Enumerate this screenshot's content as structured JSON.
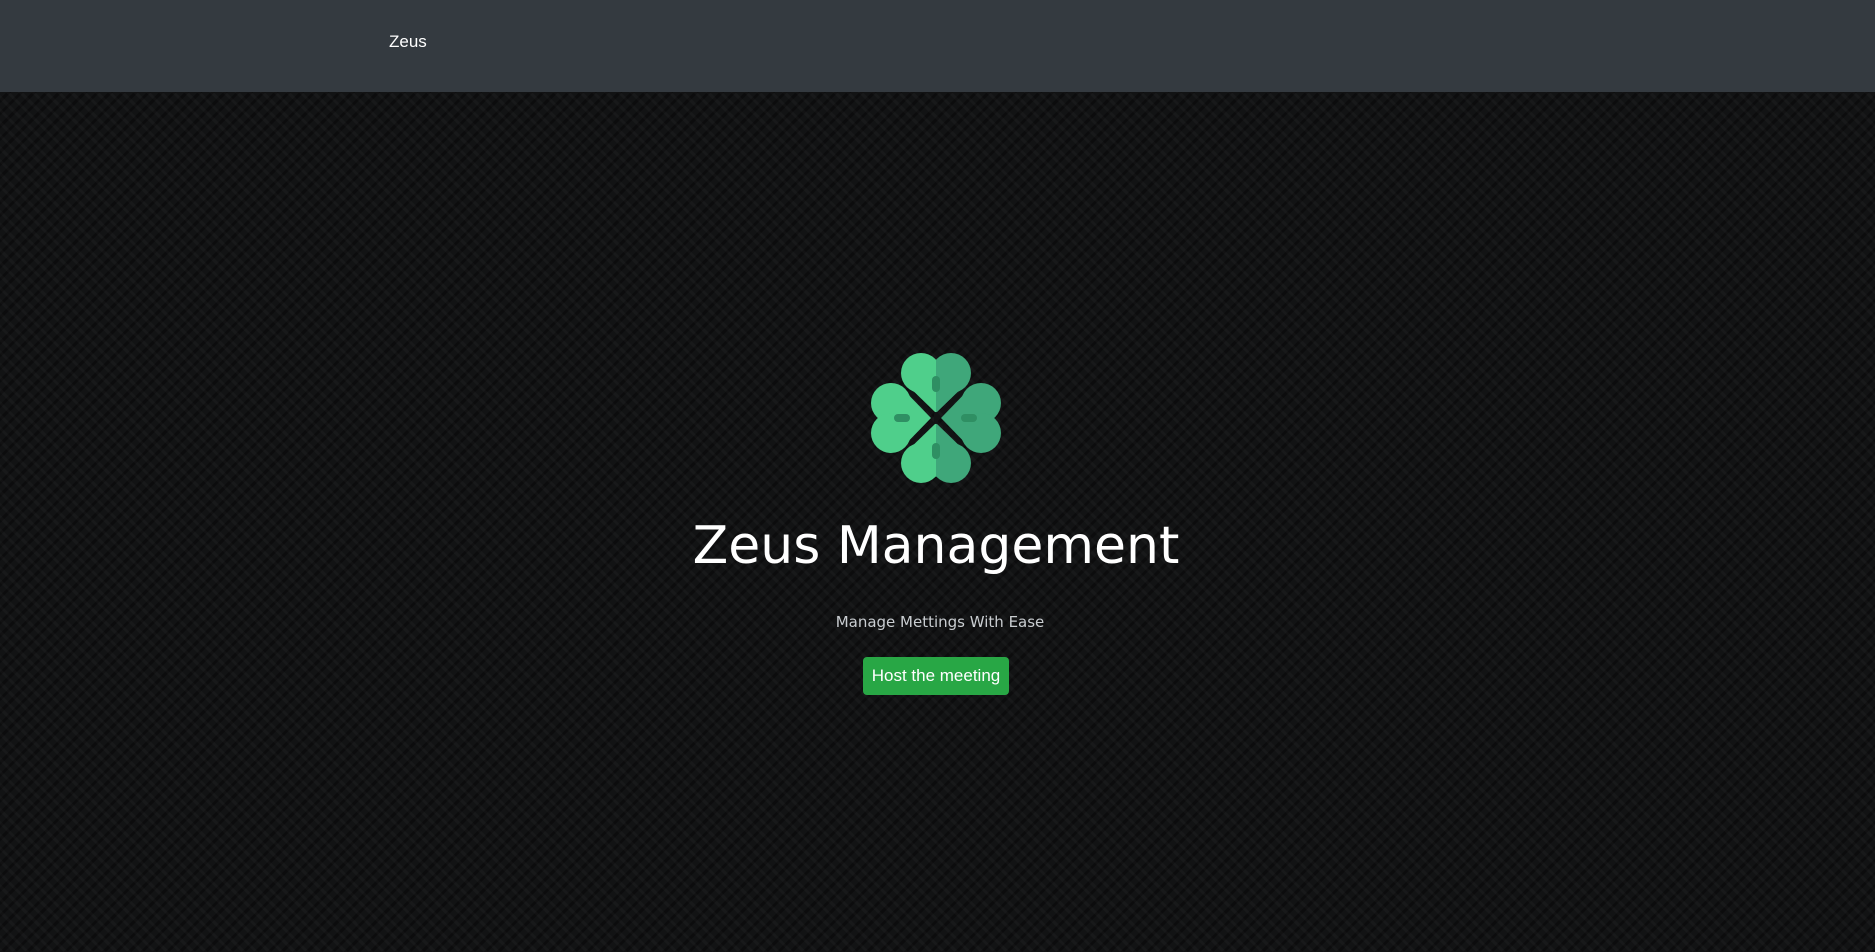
{
  "navbar": {
    "brand": "Zeus"
  },
  "hero": {
    "logo_icon": "clover-icon",
    "title": "Zeus Management",
    "subtitle": "Manage Mettings With Ease",
    "cta_label": "Host the meeting"
  },
  "colors": {
    "navbar_bg": "#343a40",
    "page_bg": "#121314",
    "logo_light": "#4fcf8b",
    "logo_dark": "#3fa77a",
    "button_bg": "#28a745",
    "text": "#ffffff"
  }
}
